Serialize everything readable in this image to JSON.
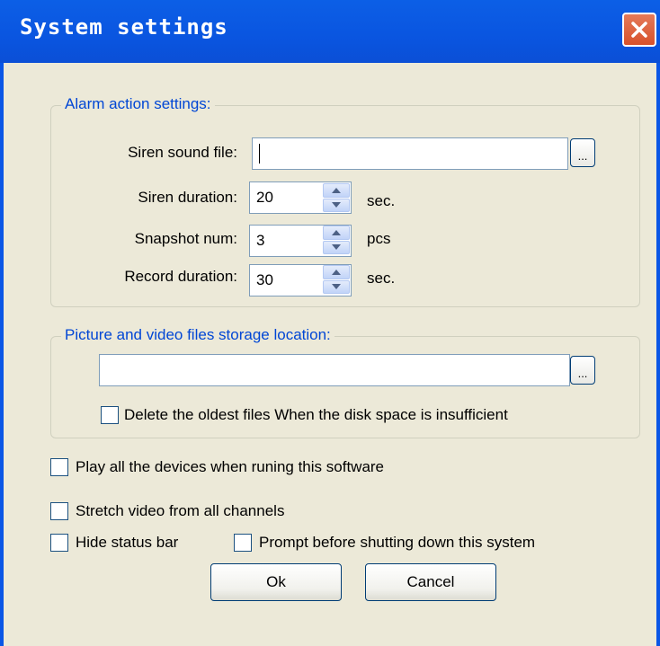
{
  "window": {
    "title": "System settings"
  },
  "alarm_group": {
    "legend": "Alarm action settings:",
    "siren_file_label": "Siren sound file:",
    "siren_file_value": "",
    "browse_label": "...",
    "siren_duration_label": "Siren duration:",
    "siren_duration_value": "20",
    "siren_duration_unit": "sec.",
    "snapshot_label": "Snapshot num:",
    "snapshot_value": "3",
    "snapshot_unit": "pcs",
    "record_duration_label": "Record duration:",
    "record_duration_value": "30",
    "record_duration_unit": "sec."
  },
  "storage_group": {
    "legend": "Picture and video files storage location:",
    "path_value": "",
    "browse_label": "...",
    "delete_oldest_label": "Delete the oldest files When the disk space is insufficient"
  },
  "options": {
    "play_all_label": "Play all the devices when runing this software",
    "stretch_label": "Stretch video from all channels",
    "hide_status_label": "Hide status bar",
    "prompt_shutdown_label": "Prompt before shutting down this system"
  },
  "buttons": {
    "ok_label": "Ok",
    "cancel_label": "Cancel"
  },
  "colors": {
    "titlebar": "#0a55e0",
    "close_button": "#d8512b",
    "dialog_face": "#ece9d8",
    "legend_text": "#0046d5"
  }
}
